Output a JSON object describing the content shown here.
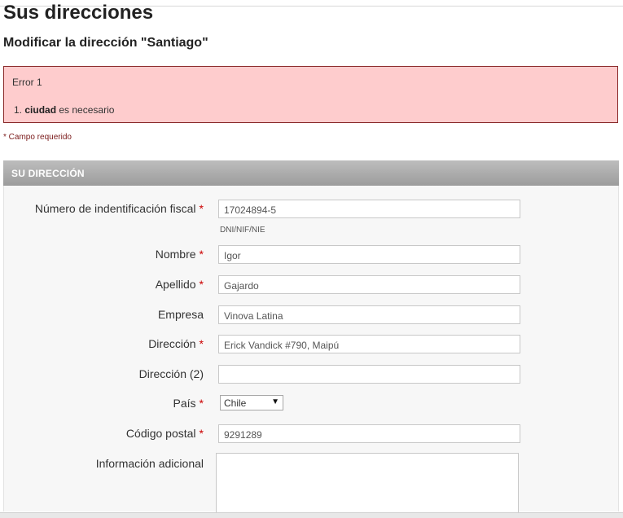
{
  "page": {
    "title": "Sus direcciones",
    "subtitle": "Modificar la dirección \"Santiago\""
  },
  "error": {
    "title": "Error 1",
    "item_number": "1.",
    "item_field": "ciudad",
    "item_message": " es necesario"
  },
  "required_note": "* Campo requerido",
  "form": {
    "section_title": "SU DIRECCIÓN",
    "required_mark": "*",
    "tax_id": {
      "label": "Número de indentificación fiscal",
      "value": "17024894-5",
      "hint": "DNI/NIF/NIE"
    },
    "first_name": {
      "label": "Nombre",
      "value": "Igor"
    },
    "last_name": {
      "label": "Apellido",
      "value": "Gajardo"
    },
    "company": {
      "label": "Empresa",
      "value": "Vinova Latina"
    },
    "address": {
      "label": "Dirección",
      "value": "Erick Vandick #790, Maipú"
    },
    "address2": {
      "label": "Dirección (2)",
      "value": ""
    },
    "country": {
      "label": "País",
      "value": "Chile"
    },
    "postal_code": {
      "label": "Código postal",
      "value": "9291289"
    },
    "additional_info": {
      "label": "Información adicional",
      "value": ""
    }
  }
}
